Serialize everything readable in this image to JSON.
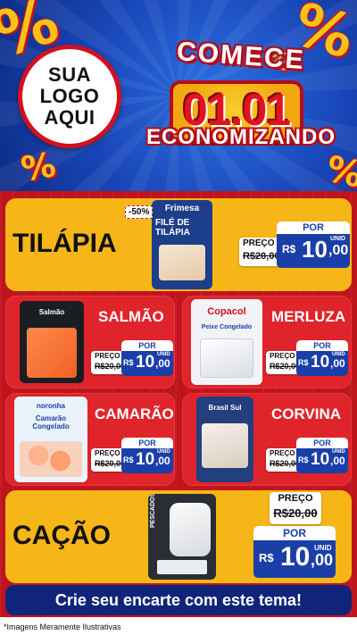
{
  "header": {
    "logo_lines": [
      "SUA",
      "LOGO",
      "AQUI"
    ],
    "headline_top": "COMECE",
    "headline_date": "01.01",
    "headline_bottom": "ECONOMIZANDO",
    "percent_symbol": "%"
  },
  "featured_top": {
    "name": "TILÁPIA",
    "product_brand": "Frimesa",
    "product_label": "FILÉ DE TILÁPIA",
    "discount_badge": "-50%",
    "price_label": "PREÇO",
    "old_price": "R$20,00",
    "por_label": "POR",
    "currency": "R$",
    "price_int": "10",
    "price_dec": ",00",
    "unit": "UNID"
  },
  "grid": [
    {
      "name": "SALMÃO",
      "product_label": "Salmão",
      "price_label": "PREÇO",
      "old_price": "R$20,00",
      "por_label": "POR",
      "currency": "R$",
      "price_int": "10",
      "price_dec": ",00",
      "unit": "UNID"
    },
    {
      "name": "MERLUZA",
      "product_label": "Copacol",
      "product_sub": "Peixe Congelado",
      "price_label": "PREÇO",
      "old_price": "R$20,00",
      "por_label": "POR",
      "currency": "R$",
      "price_int": "10",
      "price_dec": ",00",
      "unit": "UNID"
    },
    {
      "name": "CAMARÃO",
      "product_label": "Camarão Congelado",
      "product_brand": "noronha",
      "price_label": "PREÇO",
      "old_price": "R$20,00",
      "por_label": "POR",
      "currency": "R$",
      "price_int": "10",
      "price_dec": ",00",
      "unit": "UNID"
    },
    {
      "name": "CORVINA",
      "product_label": "Brasil Sul",
      "price_label": "PREÇO",
      "old_price": "R$20,00",
      "por_label": "POR",
      "currency": "R$",
      "price_int": "10",
      "price_dec": ",00",
      "unit": "UNID"
    }
  ],
  "featured_bottom": {
    "name": "CAÇÃO",
    "product_label": "PESCADOS",
    "price_label": "PREÇO",
    "old_price": "R$20,00",
    "por_label": "POR",
    "currency": "R$",
    "price_int": "10",
    "price_dec": ",00",
    "unit": "UNID"
  },
  "cta": "Crie seu encarte com este tema!",
  "disclaimer": "*Imagens Meramente Ilustrativas",
  "colors": {
    "red": "#c0141d",
    "yellow": "#f6b617",
    "blue": "#1a3fa8",
    "navy": "#10257a"
  }
}
